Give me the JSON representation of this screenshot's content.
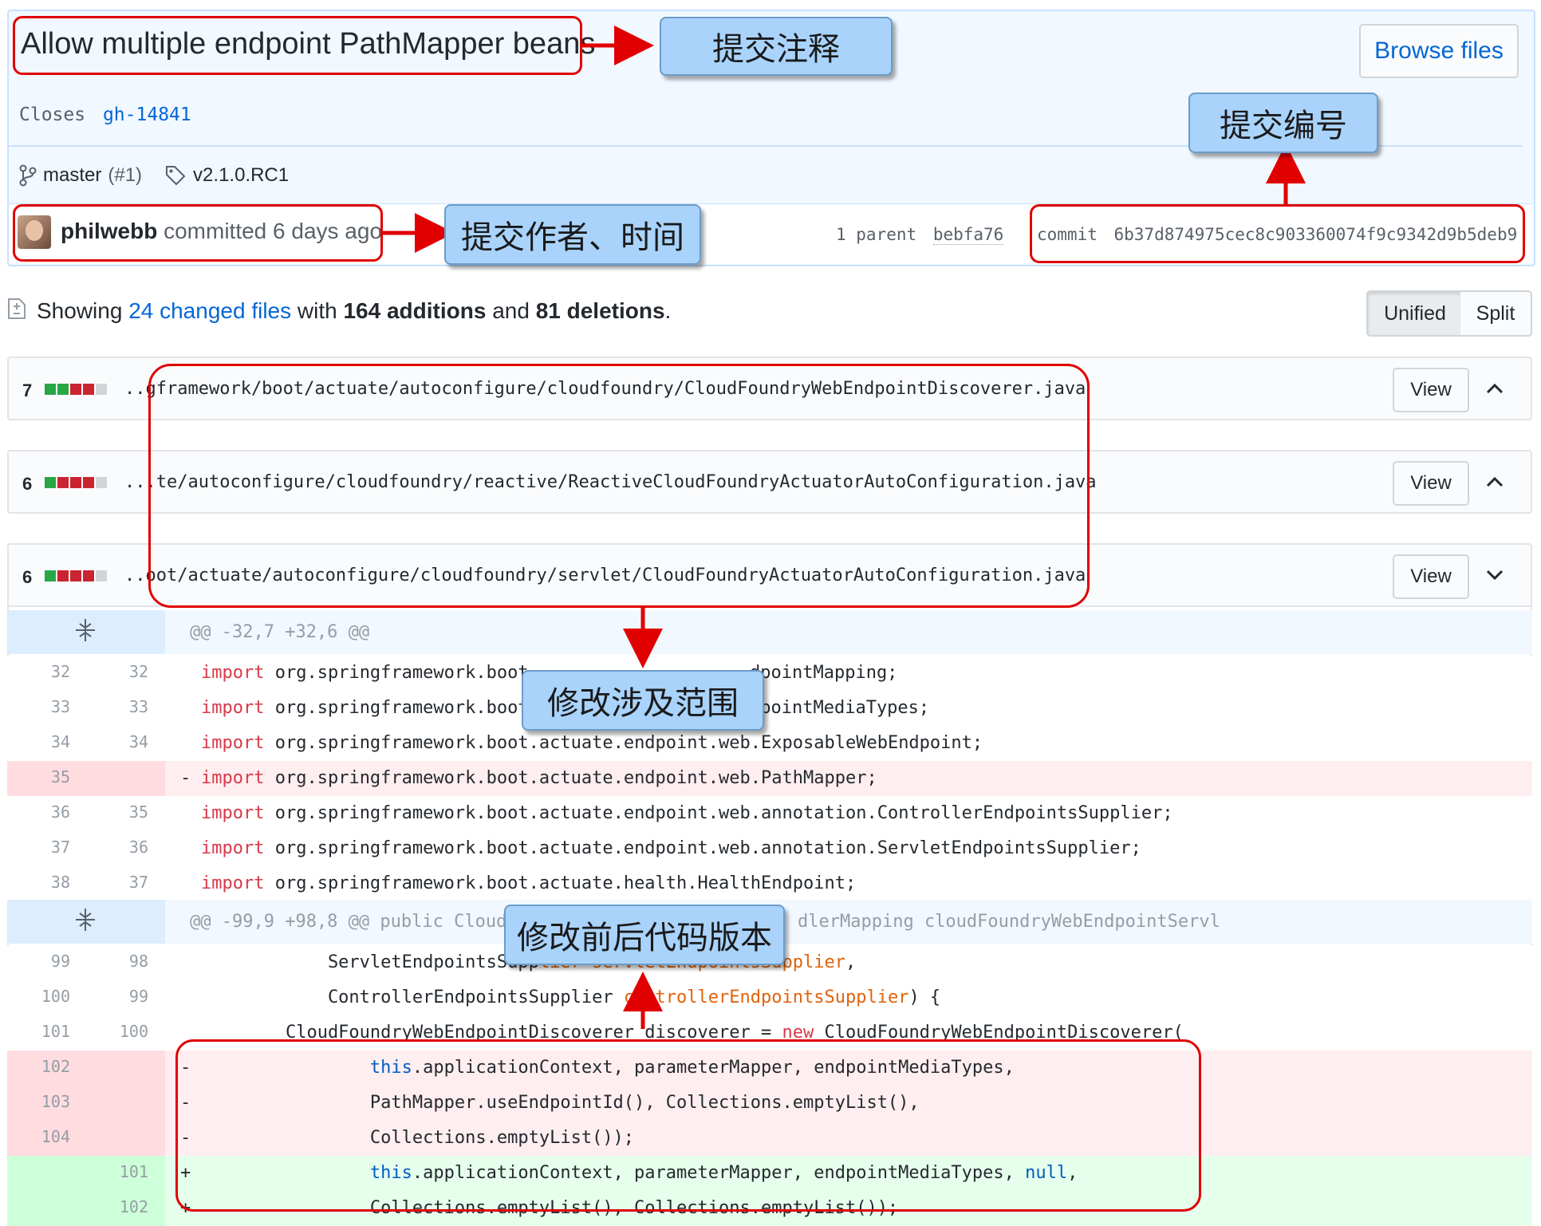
{
  "commit": {
    "title": "Allow multiple endpoint PathMapper beans",
    "browse_files": "Browse files",
    "closes_label": "Closes",
    "closes_issue": "gh-14841",
    "branch": "master",
    "branch_pr": "(#1)",
    "tag": "v2.1.0.RC1",
    "author": "philwebb",
    "committed_text": "committed 6 days ago",
    "parent_label": "1 parent",
    "parent_sha": "bebfa76",
    "commit_label": "commit",
    "commit_sha": "6b37d874975cec8c903360074f9c9342d9b5deb9"
  },
  "annotations": {
    "commit_message": "提交注释",
    "commit_number": "提交编号",
    "author_time": "提交作者、时间",
    "scope": "修改涉及范围",
    "versions": "修改前后代码版本"
  },
  "summary": {
    "showing": "Showing",
    "changed_files": "24 changed files",
    "with": "with",
    "additions": "164 additions",
    "and": "and",
    "deletions": "81 deletions",
    "period": "."
  },
  "view_toggle": {
    "unified": "Unified",
    "split": "Split",
    "selected": "Unified"
  },
  "files": [
    {
      "count": "7",
      "path": "..gframework/boot/actuate/autoconfigure/cloudfoundry/CloudFoundryWebEndpointDiscoverer.java",
      "view": "View",
      "bars": [
        "#28a745",
        "#28a745",
        "#cb2431",
        "#cb2431",
        "#d1d5da"
      ],
      "expanded": false
    },
    {
      "count": "6",
      "path": "...te/autoconfigure/cloudfoundry/reactive/ReactiveCloudFoundryActuatorAutoConfiguration.java",
      "view": "View",
      "bars": [
        "#28a745",
        "#cb2431",
        "#cb2431",
        "#cb2431",
        "#d1d5da"
      ],
      "expanded": false
    },
    {
      "count": "6",
      "path": "..oot/actuate/autoconfigure/cloudfoundry/servlet/CloudFoundryActuatorAutoConfiguration.java",
      "view": "View",
      "bars": [
        "#28a745",
        "#cb2431",
        "#cb2431",
        "#cb2431",
        "#d1d5da"
      ],
      "expanded": true
    }
  ],
  "diff": {
    "hunk1": "@@ -32,7 +32,6 @@",
    "hunk2_a": "@@ -99,9 +98,8 @@ public Cloud",
    "hunk2_b": "dlerMapping cloudFoundryWebEndpointServl",
    "lines": [
      {
        "type": "ctx",
        "old": "32",
        "new": "32",
        "sign": " ",
        "kw": "import",
        "text": " org.springframework.boot",
        "tail": "dpointMapping;"
      },
      {
        "type": "ctx",
        "old": "33",
        "new": "33",
        "sign": " ",
        "kw": "import",
        "text": " org.springframework.boot",
        "tail": "dpointMediaTypes;"
      },
      {
        "type": "ctx",
        "old": "34",
        "new": "34",
        "sign": " ",
        "kw": "import",
        "text": " org.springframework.boot.actuate.endpoint.web.ExposableWebEndpoint;",
        "tail": ""
      },
      {
        "type": "del",
        "old": "35",
        "new": "",
        "sign": "-",
        "kw": "import",
        "text": " org.springframework.boot.actuate.endpoint.web.PathMapper;",
        "tail": ""
      },
      {
        "type": "ctx",
        "old": "36",
        "new": "35",
        "sign": " ",
        "kw": "import",
        "text": " org.springframework.boot.actuate.endpoint.web.annotation.ControllerEndpointsSupplier;",
        "tail": ""
      },
      {
        "type": "ctx",
        "old": "37",
        "new": "36",
        "sign": " ",
        "kw": "import",
        "text": " org.springframework.boot.actuate.endpoint.web.annotation.ServletEndpointsSupplier;",
        "tail": ""
      },
      {
        "type": "ctx",
        "old": "38",
        "new": "37",
        "sign": " ",
        "kw": "import",
        "text": " org.springframework.boot.actuate.health.HealthEndpoint;",
        "tail": ""
      }
    ],
    "lines2": [
      {
        "type": "ctx",
        "old": "99",
        "new": "98",
        "sign": " ",
        "a": "            ServletEndpointsSupp",
        "b": "lier servletEndpointsSupplier",
        "c": ","
      },
      {
        "type": "ctx",
        "old": "100",
        "new": "99",
        "sign": " ",
        "a": "            ControllerEndpointsSupplier ",
        "b": "controllerEndpointsSupplier",
        "c": ") {"
      },
      {
        "type": "ctx",
        "old": "101",
        "new": "100",
        "sign": " ",
        "a": "        CloudFoundryWebEndpointDiscoverer discoverer = ",
        "b": "new",
        "c": " CloudFoundryWebEndpointDiscoverer("
      },
      {
        "type": "del",
        "old": "102",
        "new": "",
        "sign": "-",
        "a": "                ",
        "b": "this",
        "c": ".applicationContext, parameterMapper, endpointMediaTypes,"
      },
      {
        "type": "del",
        "old": "103",
        "new": "",
        "sign": "-",
        "a": "                PathMapper.useEndpointId(), Collections.emptyList(),",
        "b": "",
        "c": ""
      },
      {
        "type": "del",
        "old": "104",
        "new": "",
        "sign": "-",
        "a": "                Collections.emptyList());",
        "b": "",
        "c": ""
      },
      {
        "type": "add",
        "old": "",
        "new": "101",
        "sign": "+",
        "a": "                ",
        "b": "this",
        "c": ".applicationContext, parameterMapper, endpointMediaTypes, ",
        "d": "null",
        "e": ","
      },
      {
        "type": "add",
        "old": "",
        "new": "102",
        "sign": "+",
        "a": "                Collections.emptyList(), Collections.emptyList());",
        "b": "",
        "c": ""
      }
    ]
  }
}
